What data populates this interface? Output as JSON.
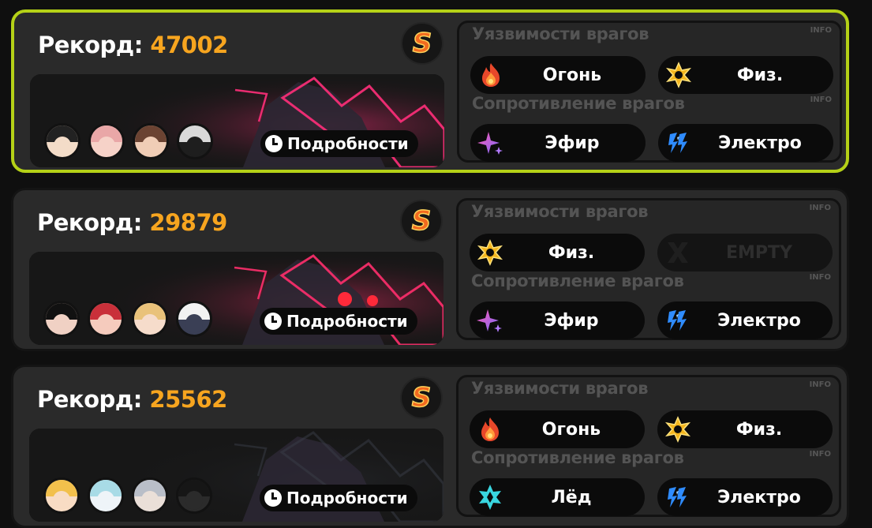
{
  "record_label": "Рекорд:",
  "details_label": "Подробности",
  "weakness_title": "Уязвимости врагов",
  "resistance_title": "Сопротивление врагов",
  "info_label": "INFO",
  "rank": "S",
  "colors": {
    "accent": "#b5d117",
    "record": "#f7a51f",
    "rank": "#f26a1f"
  },
  "cards": [
    {
      "score": "47002",
      "selected": true,
      "avatars": [
        {
          "hair": "#222",
          "face": "#f3dcc8"
        },
        {
          "hair": "#e9a7a7",
          "face": "#f6d2c8"
        },
        {
          "hair": "#6b4332",
          "face": "#f0cdb6"
        },
        {
          "hair": "#d9d9d9",
          "face": "#1e1e1e"
        }
      ],
      "weaknesses": [
        {
          "icon": "fire-icon",
          "label": "Огонь"
        },
        {
          "icon": "physical-icon",
          "label": "Физ."
        }
      ],
      "resistances": [
        {
          "icon": "ether-icon",
          "label": "Эфир"
        },
        {
          "icon": "electric-icon",
          "label": "Электро"
        }
      ]
    },
    {
      "score": "29879",
      "selected": false,
      "avatars": [
        {
          "hair": "#111",
          "face": "#f0d1c4"
        },
        {
          "hair": "#c9303a",
          "face": "#f5cbbd"
        },
        {
          "hair": "#e9c27a",
          "face": "#f6dccb"
        },
        {
          "hair": "#f2f2f2",
          "face": "#3a3f55"
        }
      ],
      "weaknesses": [
        {
          "icon": "physical-icon",
          "label": "Физ."
        },
        {
          "icon": "x-icon",
          "label": "EMPTY",
          "empty": true
        }
      ],
      "resistances": [
        {
          "icon": "ether-icon",
          "label": "Эфир"
        },
        {
          "icon": "electric-icon",
          "label": "Электро"
        }
      ]
    },
    {
      "score": "25562",
      "selected": false,
      "avatars": [
        {
          "hair": "#f2c04c",
          "face": "#f8dcc4"
        },
        {
          "hair": "#a8dbe6",
          "face": "#eef4f8"
        },
        {
          "hair": "#b9bec8",
          "face": "#eadfd8"
        },
        {
          "hair": "#161616",
          "face": "#2b2b2b"
        }
      ],
      "weaknesses": [
        {
          "icon": "fire-icon",
          "label": "Огонь"
        },
        {
          "icon": "physical-icon",
          "label": "Физ."
        }
      ],
      "resistances": [
        {
          "icon": "ice-icon",
          "label": "Лёд"
        },
        {
          "icon": "electric-icon",
          "label": "Электро"
        }
      ]
    }
  ]
}
